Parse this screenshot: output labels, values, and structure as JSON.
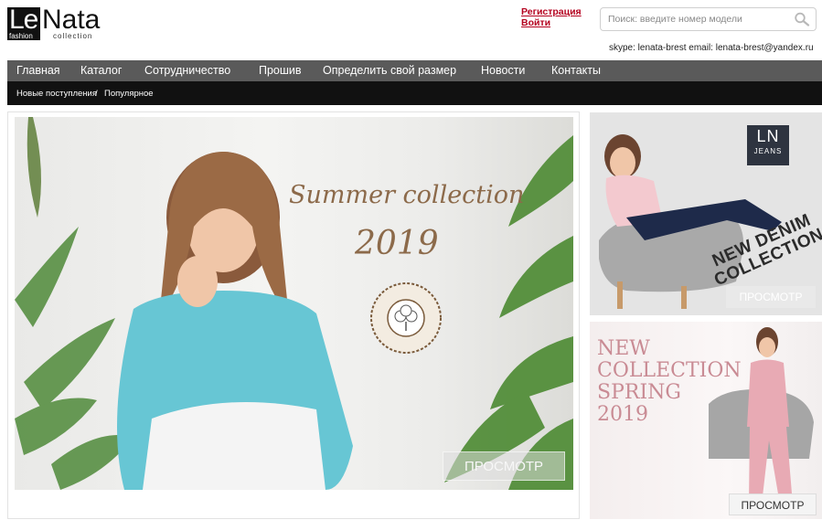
{
  "logo": {
    "le": "Le",
    "nata": "Nata",
    "fashion": "fashion",
    "collection": "collection"
  },
  "auth": {
    "register": "Регистрация",
    "login": "Войти"
  },
  "search": {
    "placeholder": "Поиск: введите номер модели"
  },
  "contacts": {
    "text": "skype: lenata-brest   email: lenata-brest@yandex.ru"
  },
  "nav": {
    "items": [
      "Главная",
      "Каталог",
      "Сотрудничество",
      "Прошив",
      "Определить свой размер",
      "Новости",
      "Контакты"
    ]
  },
  "subnav": {
    "new": "Новые поступления",
    "sep": "/",
    "popular": "Популярное"
  },
  "banner_main": {
    "title": "Summer collection",
    "year": "2019",
    "badge": "ORGANIC COTTON",
    "button": "ПРОСМОТР"
  },
  "banner_side1": {
    "ln": "LN",
    "jeans": "JEANS",
    "line1": "NEW DENIM",
    "line2": "COLLECTION",
    "button": "ПРОСМОТР"
  },
  "banner_side2": {
    "line1": "NEW",
    "line2": "COLLECTION",
    "line3": "SPRING",
    "line4": "2019",
    "button": "ПРОСМОТР"
  },
  "colors": {
    "accent_red": "#b4001e",
    "nav_bg": "#5a5a5a",
    "subnav_bg": "#111111",
    "title_brown": "#8c6a4a",
    "spring_pink": "#c98b94"
  }
}
